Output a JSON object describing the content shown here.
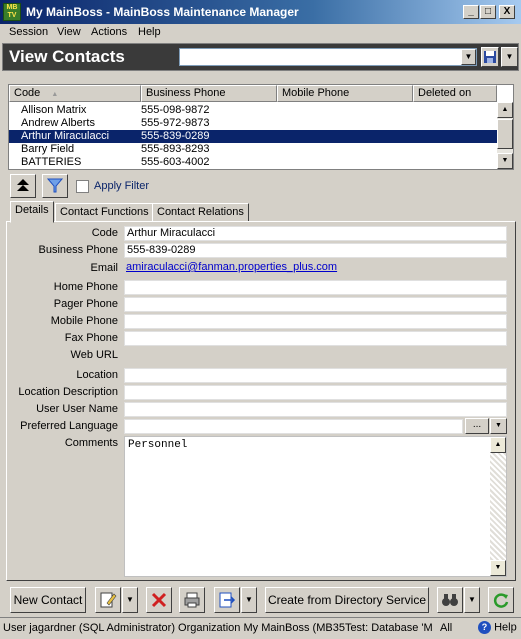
{
  "window": {
    "app_icon_text": "MB TV",
    "title": "My MainBoss - MainBoss Maintenance Manager",
    "minimize": "_",
    "maximize": "□",
    "close": "X"
  },
  "menu": [
    "Session",
    "View",
    "Actions",
    "Help"
  ],
  "header": {
    "title": "View Contacts",
    "filter_value": ""
  },
  "grid": {
    "columns": [
      "Code",
      "Business Phone",
      "Mobile Phone",
      "Deleted on"
    ],
    "sort_column": "Code",
    "rows": [
      {
        "code": "Allison Matrix",
        "business_phone": "555-098-9872",
        "selected": false
      },
      {
        "code": "Andrew Alberts",
        "business_phone": "555-972-9873",
        "selected": false
      },
      {
        "code": "Arthur Miraculacci",
        "business_phone": "555-839-0289",
        "selected": true
      },
      {
        "code": "Barry Field",
        "business_phone": "555-893-8293",
        "selected": false
      },
      {
        "code": "BATTERIES",
        "business_phone": "555-603-4002",
        "selected": false
      }
    ]
  },
  "grid_toolbar": {
    "apply_filter_label": "Apply Filter",
    "apply_filter_checked": false
  },
  "tabs": [
    {
      "label": "Details",
      "active": true
    },
    {
      "label": "Contact Functions",
      "active": false
    },
    {
      "label": "Contact Relations",
      "active": false
    }
  ],
  "details": {
    "code_label": "Code",
    "code": "Arthur Miraculacci",
    "business_phone_label": "Business Phone",
    "business_phone": "555-839-0289",
    "email_label": "Email",
    "email": "amiraculacci@fanman.properties_plus.com",
    "home_phone_label": "Home Phone",
    "home_phone": "",
    "pager_phone_label": "Pager Phone",
    "pager_phone": "",
    "mobile_phone_label": "Mobile Phone",
    "mobile_phone": "",
    "fax_phone_label": "Fax Phone",
    "fax_phone": "",
    "web_url_label": "Web URL",
    "web_url": "",
    "location_label": "Location",
    "location": "",
    "location_description_label": "Location Description",
    "location_description": "",
    "user_user_name_label": "User User Name",
    "user_user_name": "",
    "preferred_language_label": "Preferred Language",
    "preferred_language": "",
    "preferred_language_browse": "...",
    "comments_label": "Comments",
    "comments": "Personnel"
  },
  "bottom_toolbar": {
    "new_contact": "New Contact",
    "create_from_directory": "Create from Directory Service"
  },
  "status": {
    "text": "User jagardner (SQL Administrator) Organization My MainBoss (MB35Test: Database 'MB35",
    "all": "All",
    "help": "Help"
  }
}
